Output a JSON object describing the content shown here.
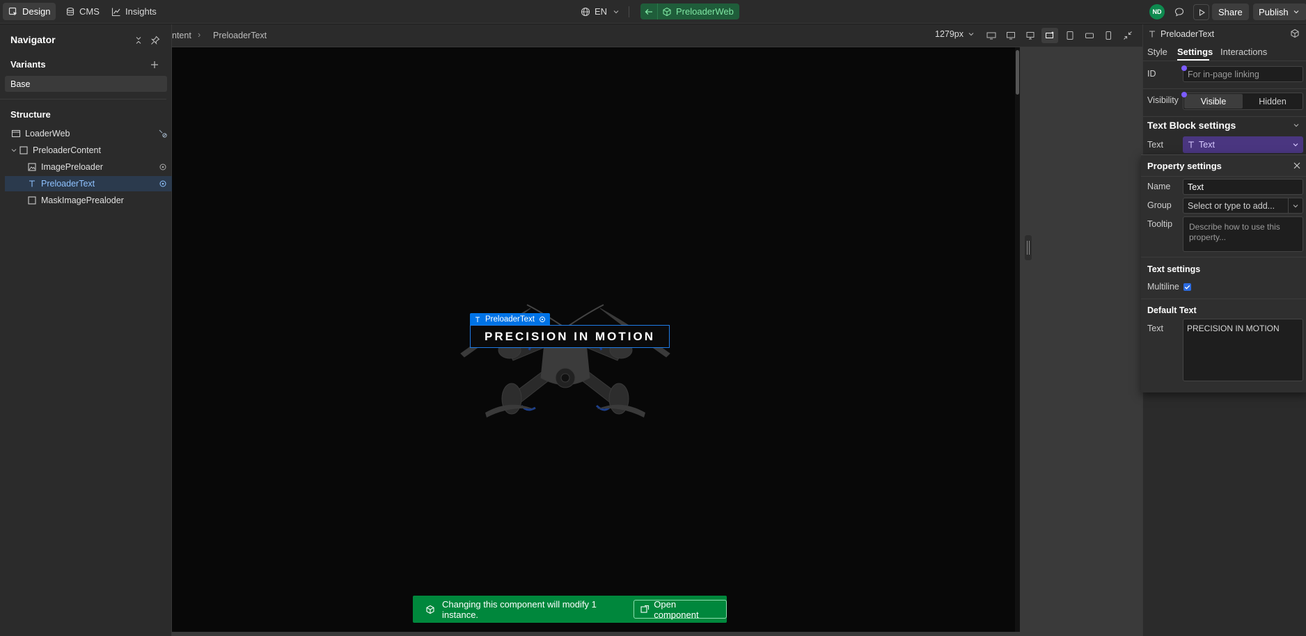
{
  "topbar": {
    "tabs": [
      {
        "label": "Design",
        "icon": "design-cursor-icon",
        "active": true
      },
      {
        "label": "CMS",
        "icon": "database-icon",
        "active": false
      },
      {
        "label": "Insights",
        "icon": "chart-icon",
        "active": false
      }
    ],
    "language": "EN",
    "component_name": "PreloaderWeb",
    "avatar_initials": "ND",
    "share_label": "Share",
    "publish_label": "Publish"
  },
  "navigator": {
    "title": "Navigator",
    "variants_title": "Variants",
    "variant_base": "Base",
    "structure_title": "Structure",
    "tree": [
      {
        "label": "LoaderWeb"
      },
      {
        "label": "PreloaderContent"
      },
      {
        "label": "ImagePreloader"
      },
      {
        "label": "PreloaderText"
      },
      {
        "label": "MaskImagePrealoder"
      }
    ]
  },
  "breadcrumb": {
    "parent": "ntent",
    "current": "PreloaderText",
    "width_label": "1279px"
  },
  "canvas": {
    "selection_label": "PreloaderText",
    "text": "PRECISION IN MOTION",
    "toast_message": "Changing this component will modify 1 instance.",
    "toast_button": "Open component"
  },
  "panel": {
    "element_name": "PreloaderText",
    "tabs": [
      "Style",
      "Settings",
      "Interactions"
    ],
    "active_tab": "Settings",
    "id_label": "ID",
    "id_placeholder": "For in-page linking",
    "visibility_label": "Visibility",
    "visible_label": "Visible",
    "hidden_label": "Hidden",
    "text_block_title": "Text Block settings",
    "text_label": "Text",
    "text_value": "Text",
    "property_settings_title": "Property settings",
    "name_label": "Name",
    "name_value": "Text",
    "group_label": "Group",
    "group_placeholder": "Select or type to add...",
    "tooltip_label": "Tooltip",
    "tooltip_placeholder": "Describe how to use this property...",
    "text_settings_title": "Text settings",
    "multiline_label": "Multiline",
    "default_text_title": "Default Text",
    "default_text_label": "Text",
    "default_text_value": "PRECISION IN MOTION"
  },
  "colors": {
    "accent": "#0073e6",
    "component_green": "#0e8a4f",
    "toast_green": "#00873c",
    "text_binding_purple": "#4a3680"
  }
}
